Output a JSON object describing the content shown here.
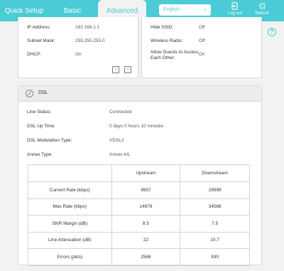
{
  "nav": {
    "tabs": [
      {
        "label": "Quick Setup"
      },
      {
        "label": "Basic"
      },
      {
        "label": "Advanced"
      }
    ],
    "language": "English",
    "logout_label": "Log out",
    "reboot_label": "Reboot",
    "help_label": "?"
  },
  "lan": {
    "rows": [
      {
        "label": "IP Address:",
        "value": "192.168.1.1"
      },
      {
        "label": "Subnet Mask:",
        "value": "255.255.255.0"
      },
      {
        "label": "DHCP:",
        "value": "On"
      }
    ],
    "prev_label": "‹",
    "next_label": "›"
  },
  "wireless": {
    "rows": [
      {
        "label": "Hide SSID:",
        "value": "Off"
      },
      {
        "label": "Wireless Radio:",
        "value": "Off"
      },
      {
        "label": "Allow Guests to Access Each Other:",
        "value": "On"
      }
    ]
  },
  "dsl": {
    "title": "DSL",
    "info": [
      {
        "label": "Line Status:",
        "value": "Connected"
      },
      {
        "label": "DSL Up Time:",
        "value": "0 days 0 hours 10 minutes"
      },
      {
        "label": "DSL Modulation Type:",
        "value": "VDSL2"
      },
      {
        "label": "Annex Type:",
        "value": "Annex A/L"
      }
    ],
    "table": {
      "headers": [
        "",
        "Upstream",
        "Downstream"
      ],
      "rows": [
        {
          "label": "Current Rate (kbps)",
          "up": "9997",
          "down": "29999"
        },
        {
          "label": "Max Rate (kbps)",
          "up": "14678",
          "down": "34566"
        },
        {
          "label": "SNR Margin (dB)",
          "up": "8.5",
          "down": "7.5"
        },
        {
          "label": "Line Attenuation (dB)",
          "up": "22",
          "down": "10.7"
        },
        {
          "label": "Errors (pkts)",
          "up": "2568",
          "down": "930"
        }
      ]
    }
  },
  "colors": {
    "accent": "#4acbd6",
    "background": "#f2f2f2"
  }
}
